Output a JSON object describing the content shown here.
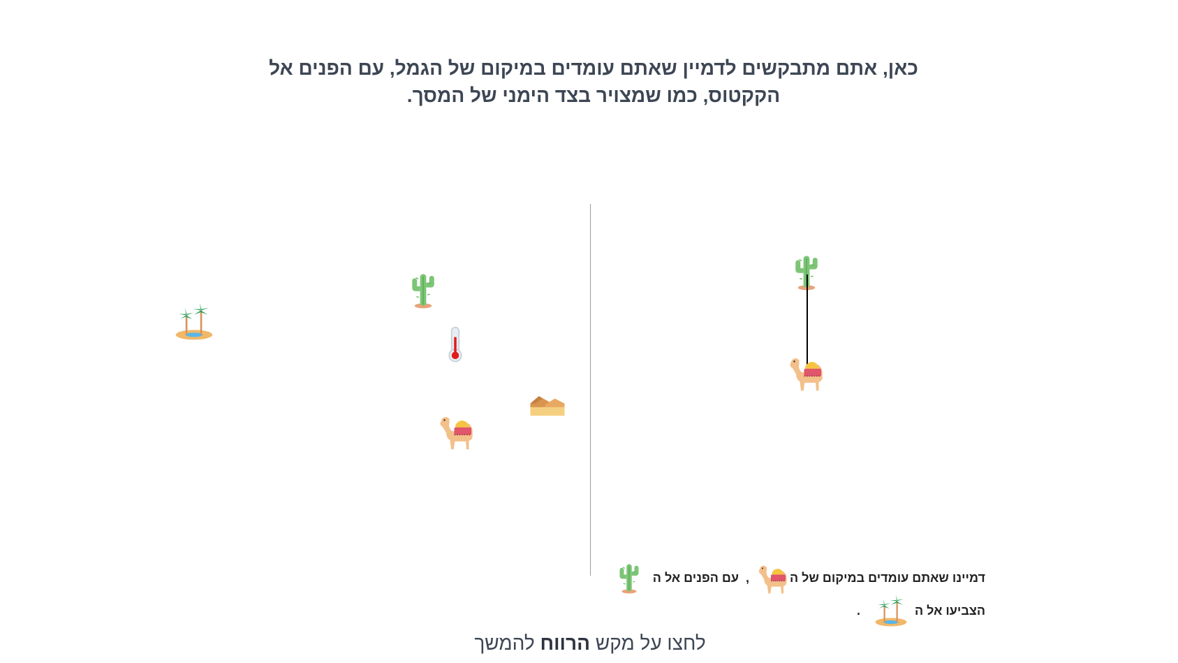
{
  "instruction": {
    "line1": "כאן, אתם מתבקשים לדמיין שאתם עומדים במיקום של הגמל, עם הפנים אל",
    "line2": "הקקטוס, כמו שמצויר בצד הימני של המסך."
  },
  "map_icons": [
    "oasis-icon",
    "cactus-icon",
    "thermometer-icon",
    "sand-dunes-icon",
    "camel-icon"
  ],
  "example_icons": [
    "cactus-icon",
    "camel-icon"
  ],
  "task": {
    "line1_part1": "דמיינו שאתם עומדים במיקום של ה",
    "line1_comma": ",",
    "line1_part2": "עם הפנים אל ה",
    "line2_part1": "הצביעו אל ה",
    "line2_period": "."
  },
  "continue": {
    "prefix": "לחצו על מקש",
    "key": "הרווח",
    "suffix": "להמשך"
  },
  "colors": {
    "text": "#3d4654",
    "divider": "#9a9a9a",
    "cactus": "#7cc576",
    "camel": "#f3c08a",
    "thermometer": "#e21b1b"
  }
}
